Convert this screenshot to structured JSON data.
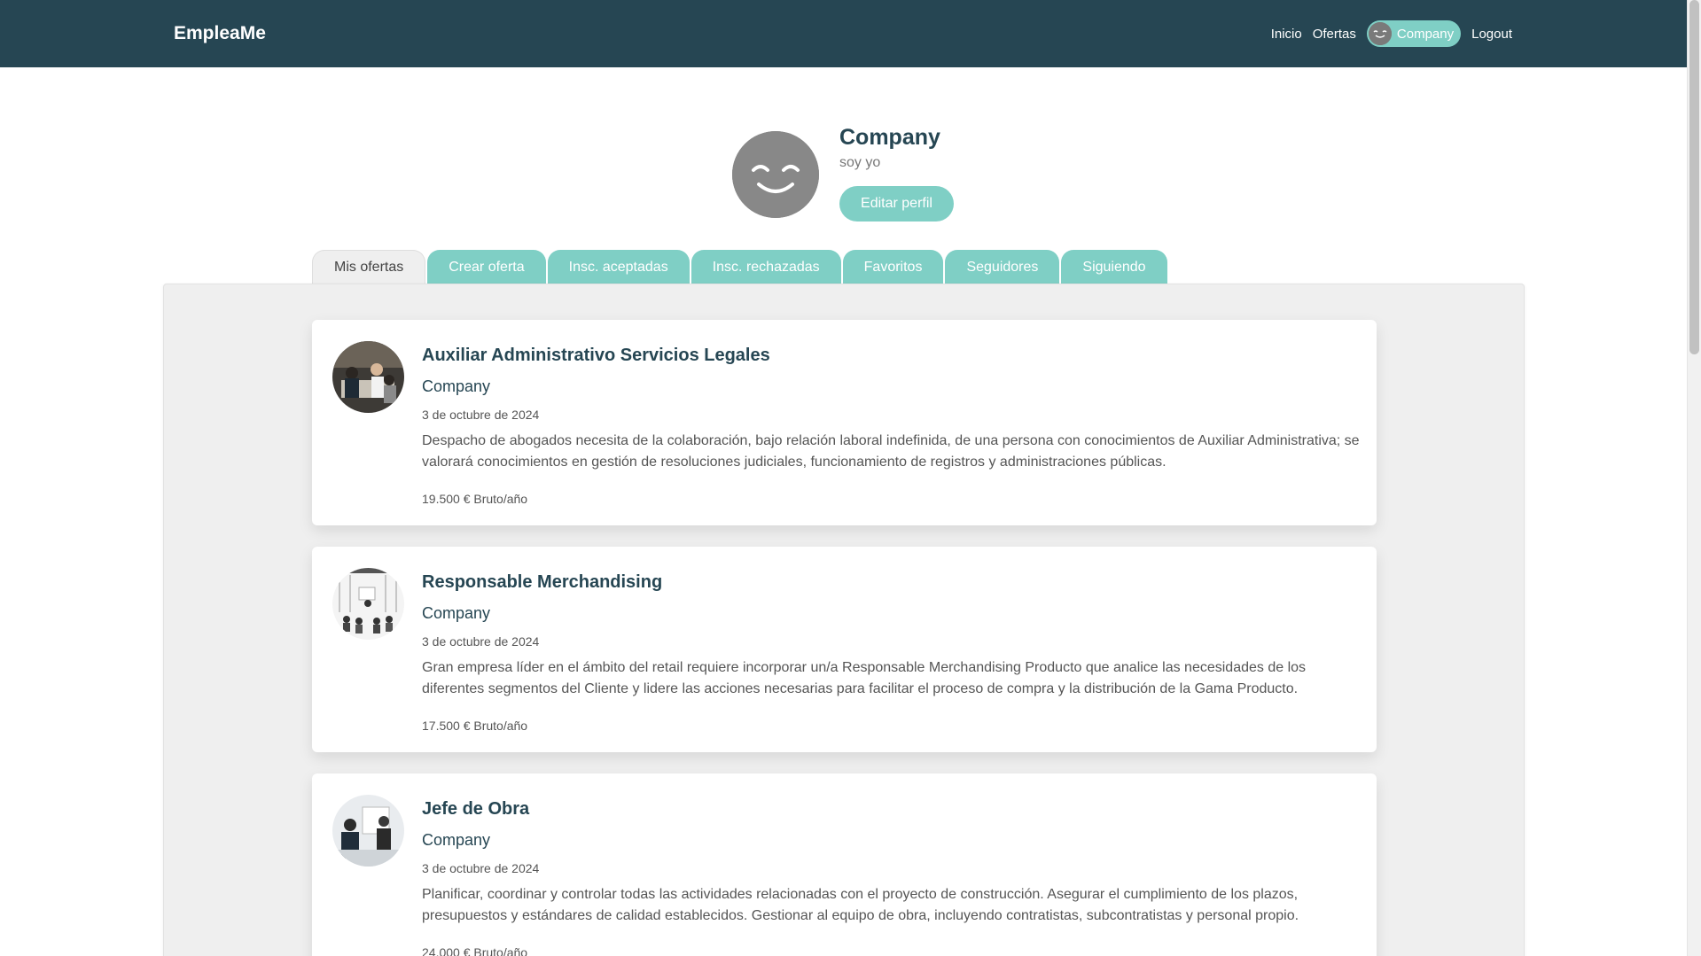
{
  "navbar": {
    "brand": "EmpleaMe",
    "links": {
      "home": "Inicio",
      "offers": "Ofertas",
      "profile": "Company",
      "logout": "Logout"
    }
  },
  "profile": {
    "name": "Company",
    "bio": "soy yo",
    "edit_label": "Editar perfil"
  },
  "tabs": [
    {
      "label": "Mis ofertas",
      "active": true
    },
    {
      "label": "Crear oferta",
      "active": false
    },
    {
      "label": "Insc. aceptadas",
      "active": false
    },
    {
      "label": "Insc. rechazadas",
      "active": false
    },
    {
      "label": "Favoritos",
      "active": false
    },
    {
      "label": "Seguidores",
      "active": false
    },
    {
      "label": "Siguiendo",
      "active": false
    }
  ],
  "offers": [
    {
      "title": "Auxiliar Administrativo Servicios Legales",
      "company": "Company",
      "date": "3 de octubre de 2024",
      "description": "Despacho de abogados necesita de la colaboración, bajo relación laboral indefinida, de una persona con conocimientos de Auxiliar Administrativa; se valorará conocimientos en gestión de resoluciones judiciales, funcionamiento de registros y administraciones públicas.",
      "salary": "19.500 € Bruto/año"
    },
    {
      "title": "Responsable Merchandising",
      "company": "Company",
      "date": "3 de octubre de 2024",
      "description": "Gran empresa líder en el ámbito del retail requiere incorporar un/a Responsable Merchandising Producto que analice las necesidades de los diferentes segmentos del Cliente y lidere las acciones necesarias para facilitar el proceso de compra y la distribución de la Gama Producto.",
      "salary": "17.500 € Bruto/año"
    },
    {
      "title": "Jefe de Obra",
      "company": "Company",
      "date": "3 de octubre de 2024",
      "description": "Planificar, coordinar y controlar todas las actividades relacionadas con el proyecto de construcción. Asegurar el cumplimiento de los plazos, presupuestos y estándares de calidad establecidos. Gestionar al equipo de obra, incluyendo contratistas, subcontratistas y personal propio.",
      "salary": "24.000 € Bruto/año"
    }
  ],
  "colors": {
    "navbar": "#264653",
    "accent": "#7fcfc5",
    "panel": "#efefef"
  }
}
